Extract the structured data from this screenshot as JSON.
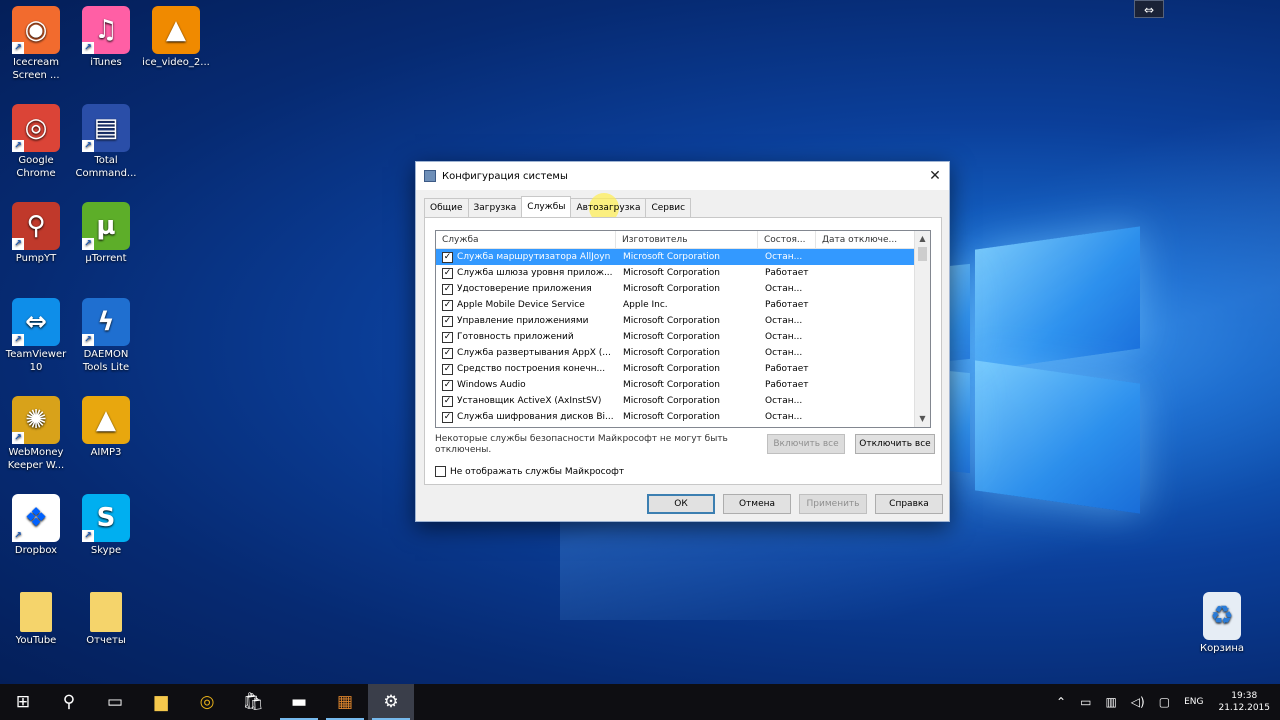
{
  "desktop": {
    "icons": [
      {
        "label": "Icecream Screen ...",
        "icon": "icecream-icon",
        "color": "#f26b2e",
        "glyph": "◉"
      },
      {
        "label": "iTunes",
        "icon": "itunes-icon",
        "color": "#ff5fa5",
        "glyph": "♫"
      },
      {
        "label": "ice_video_2...",
        "icon": "vlc-icon",
        "color": "#f08a00",
        "glyph": "▲"
      },
      {
        "label": "Google Chrome",
        "icon": "chrome-icon",
        "color": "#db4437",
        "glyph": "◎"
      },
      {
        "label": "Total Command...",
        "icon": "floppy-icon",
        "color": "#2a4ea8",
        "glyph": "▤"
      },
      {
        "label": "PumpYT",
        "icon": "pump-icon",
        "color": "#c0392b",
        "glyph": "⚲"
      },
      {
        "label": "µTorrent",
        "icon": "utorrent-icon",
        "color": "#5dae29",
        "glyph": "µ"
      },
      {
        "label": "TeamViewer 10",
        "icon": "teamviewer-icon",
        "color": "#0e8ee9",
        "glyph": "⇔"
      },
      {
        "label": "DAEMON Tools Lite",
        "icon": "daemon-icon",
        "color": "#1f6fd0",
        "glyph": "ϟ"
      },
      {
        "label": "WebMoney Keeper W...",
        "icon": "webmoney-icon",
        "color": "#d8a21a",
        "glyph": "✺"
      },
      {
        "label": "AIMP3",
        "icon": "aimp-icon",
        "color": "#e8a70e",
        "glyph": "▲"
      },
      {
        "label": "Dropbox",
        "icon": "dropbox-icon",
        "color": "#ffffff",
        "glyph": "❖"
      },
      {
        "label": "Skype",
        "icon": "skype-icon",
        "color": "#00aff0",
        "glyph": "S"
      },
      {
        "label": "YouTube",
        "icon": "folder-icon",
        "color": "#f5d46b",
        "glyph": ""
      },
      {
        "label": "Отчеты",
        "icon": "folder-icon",
        "color": "#f5d46b",
        "glyph": ""
      },
      {
        "label": "Корзина",
        "icon": "recycle-bin-icon",
        "color": "#e6edf5",
        "glyph": "♻"
      }
    ]
  },
  "dialog": {
    "title": "Конфигурация системы",
    "tabs": [
      "Общие",
      "Загрузка",
      "Службы",
      "Автозагрузка",
      "Сервис"
    ],
    "active_tab": "Службы",
    "columns": [
      "Служба",
      "Изготовитель",
      "Состоя...",
      "Дата отключе..."
    ],
    "rows": [
      {
        "name": "Служба маршрутизатора AllJoyn",
        "maker": "Microsoft Corporation",
        "state": "Остан...",
        "checked": true,
        "selected": true
      },
      {
        "name": "Служба шлюза уровня прилож...",
        "maker": "Microsoft Corporation",
        "state": "Работает",
        "checked": true
      },
      {
        "name": "Удостоверение приложения",
        "maker": "Microsoft Corporation",
        "state": "Остан...",
        "checked": true
      },
      {
        "name": "Apple Mobile Device Service",
        "maker": "Apple Inc.",
        "state": "Работает",
        "checked": true
      },
      {
        "name": "Управление приложениями",
        "maker": "Microsoft Corporation",
        "state": "Остан...",
        "checked": true
      },
      {
        "name": "Готовность приложений",
        "maker": "Microsoft Corporation",
        "state": "Остан...",
        "checked": true
      },
      {
        "name": "Служба развертывания AppX (...",
        "maker": "Microsoft Corporation",
        "state": "Остан...",
        "checked": true
      },
      {
        "name": "Средство построения конечн...",
        "maker": "Microsoft Corporation",
        "state": "Работает",
        "checked": true
      },
      {
        "name": "Windows Audio",
        "maker": "Microsoft Corporation",
        "state": "Работает",
        "checked": true
      },
      {
        "name": "Установщик ActiveX (AxInstSV)",
        "maker": "Microsoft Corporation",
        "state": "Остан...",
        "checked": true
      },
      {
        "name": "Служба шифрования дисков Bi...",
        "maker": "Microsoft Corporation",
        "state": "Остан...",
        "checked": true
      }
    ],
    "note": "Некоторые службы безопасности Майкрософт не могут быть отключены.",
    "enable_all": "Включить все",
    "disable_all": "Отключить все",
    "hide_ms_label": "Не отображать службы Майкрософт",
    "ok": "ОК",
    "cancel": "Отмена",
    "apply": "Применить",
    "help": "Справка"
  },
  "taskbar": {
    "lang": "ENG",
    "time": "19:38",
    "date": "21.12.2015"
  }
}
